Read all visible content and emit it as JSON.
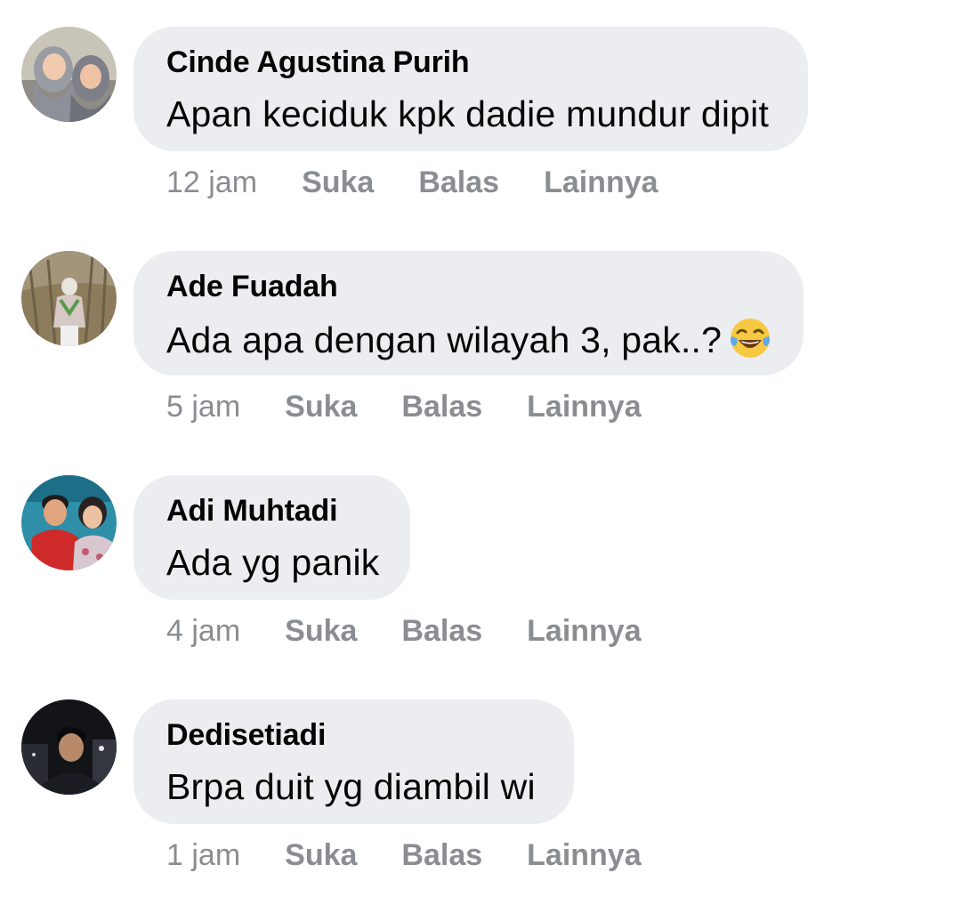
{
  "comments": [
    {
      "author": "Cinde Agustina Purih",
      "text": "Apan keciduk kpk dadie mundur dipit",
      "emoji": "",
      "time": "12 jam",
      "like": "Suka",
      "reply": "Balas",
      "more": "Lainnya"
    },
    {
      "author": "Ade Fuadah",
      "text": "Ada apa dengan wilayah 3, pak..?",
      "emoji": "face-with-tears-of-joy",
      "time": "5 jam",
      "like": "Suka",
      "reply": "Balas",
      "more": "Lainnya"
    },
    {
      "author": "Adi Muhtadi",
      "text": "Ada yg panik",
      "emoji": "",
      "time": "4 jam",
      "like": "Suka",
      "reply": "Balas",
      "more": "Lainnya"
    },
    {
      "author": "Dedisetiadi",
      "text": "Brpa duit yg diambil wi",
      "emoji": "",
      "time": "1 jam",
      "like": "Suka",
      "reply": "Balas",
      "more": "Lainnya"
    }
  ],
  "colors": {
    "bubble": "#ecedf0",
    "text": "#050505",
    "meta": "#8a8d91",
    "background": "#ffffff"
  }
}
